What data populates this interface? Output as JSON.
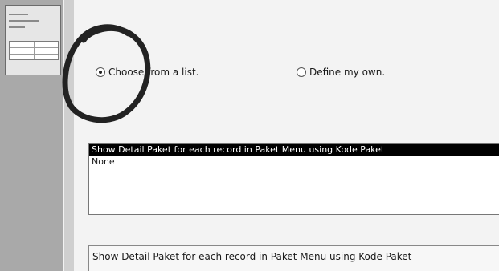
{
  "lookup_options": {
    "choose_from_list": {
      "label": "Choose from a list.",
      "selected": true
    },
    "define_my_own": {
      "label": "Define my own.",
      "selected": false
    }
  },
  "list": {
    "items": [
      "Show Detail Paket for each record in Paket Menu using Kode Paket",
      "None"
    ],
    "selected_index": 0
  },
  "description": {
    "text": "Show Detail Paket for each record in Paket Menu using Kode Paket"
  },
  "annotation": {
    "icon": "hand-drawn-circle",
    "color": "#222222"
  }
}
